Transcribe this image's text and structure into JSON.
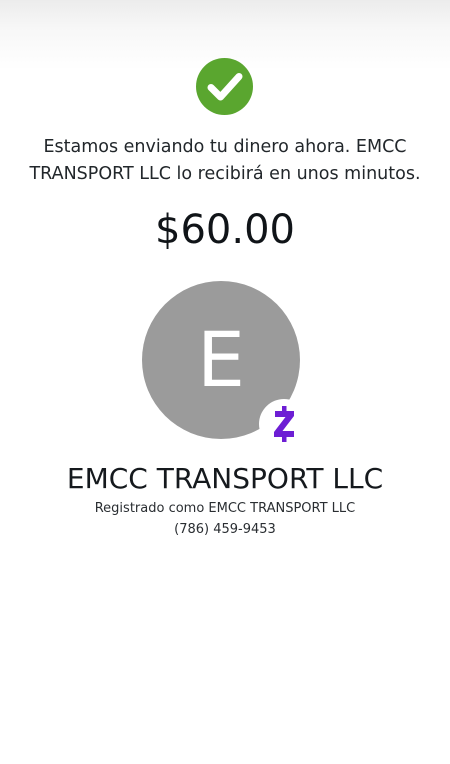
{
  "status": {
    "icon": "checkmark-icon",
    "color": "#5aa62f"
  },
  "message": {
    "line1": "Estamos enviando tu dinero ahora. EMCC",
    "line2": "TRANSPORT LLC lo recibirá en unos minutos."
  },
  "amount": "$60.00",
  "recipient": {
    "initial": "E",
    "avatar_color": "#9b9b9b",
    "badge_icon": "zelle-icon",
    "badge_color": "#6d1ed4",
    "name": "EMCC TRANSPORT LLC",
    "registered_as": "Registrado como EMCC TRANSPORT LLC",
    "phone": "(786) 459-9453"
  }
}
